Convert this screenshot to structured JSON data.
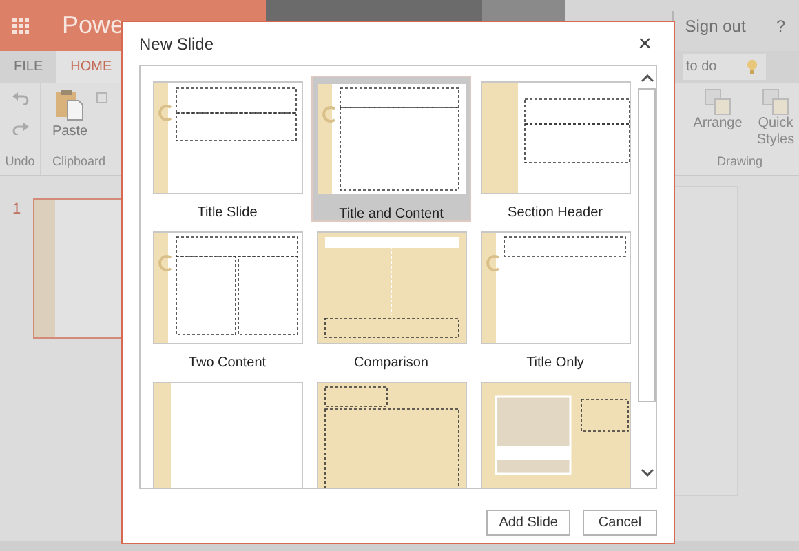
{
  "app": {
    "brand": "Powe",
    "account": {
      "sign_out": "Sign out",
      "help": "?"
    },
    "tabs": [
      {
        "label": "FILE",
        "selected": false
      },
      {
        "label": "HOME",
        "selected": true
      }
    ],
    "tell_me": "to do",
    "ribbon_left": [
      {
        "label": "Undo"
      },
      {
        "label": "Clipboard",
        "buttons": [
          "Paste"
        ]
      }
    ],
    "ribbon_right": {
      "buttons": [
        "Arrange",
        "Quick Styles"
      ],
      "group": "Drawing"
    },
    "slides": [
      {
        "number": "1",
        "selected": true
      }
    ]
  },
  "dialog": {
    "title": "New Slide",
    "close": "×",
    "layouts": [
      {
        "kind": "title-slide",
        "name": "Title Slide",
        "selected": false
      },
      {
        "kind": "title-content",
        "name": "Title and Content",
        "selected": true
      },
      {
        "kind": "section-header",
        "name": "Section Header",
        "selected": false
      },
      {
        "kind": "two-content",
        "name": "Two Content",
        "selected": false
      },
      {
        "kind": "comparison",
        "name": "Comparison",
        "selected": false
      },
      {
        "kind": "title-only",
        "name": "Title Only",
        "selected": false
      },
      {
        "kind": "blank",
        "selected": false
      },
      {
        "kind": "content-caption",
        "selected": false
      },
      {
        "kind": "picture-caption",
        "selected": false
      }
    ],
    "buttons": [
      {
        "label": "Add Slide"
      },
      {
        "label": "Cancel"
      }
    ]
  }
}
